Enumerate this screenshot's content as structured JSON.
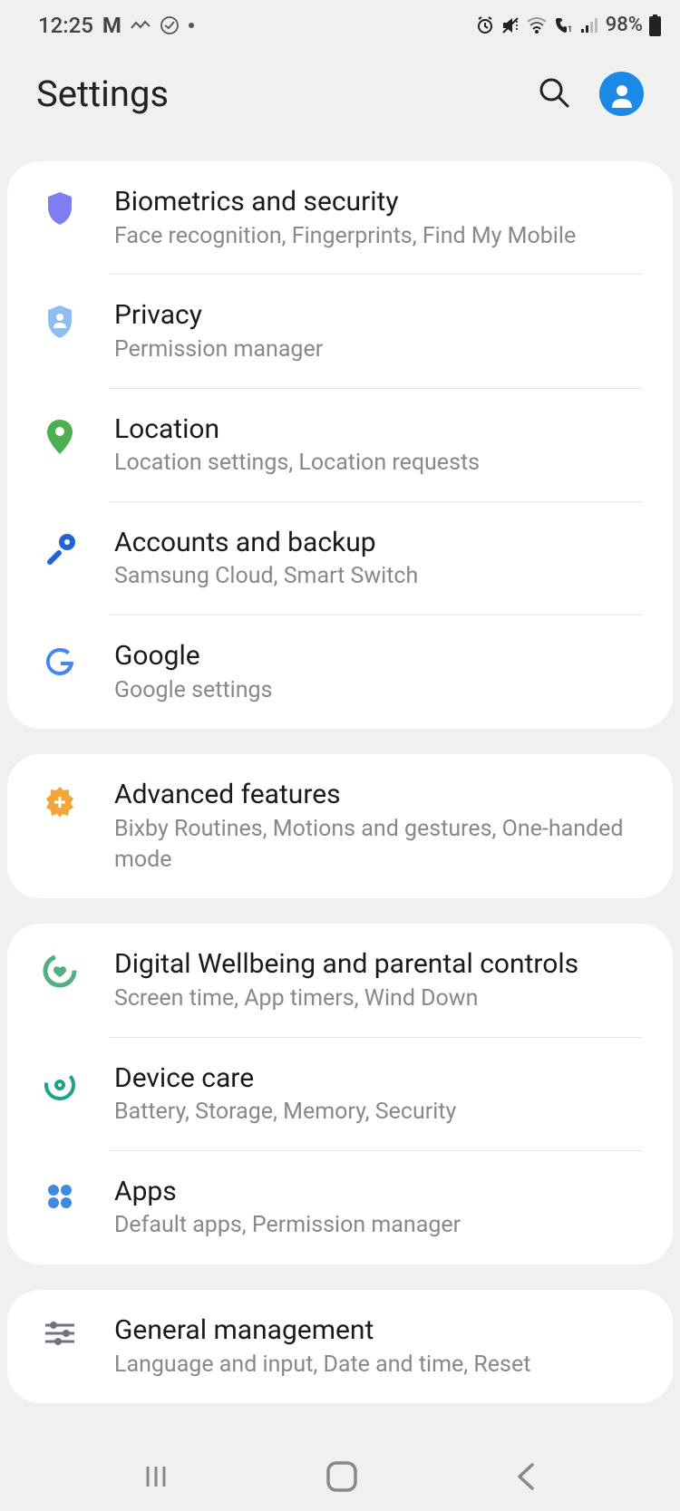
{
  "status": {
    "time": "12:25",
    "battery": "98%"
  },
  "header": {
    "title": "Settings"
  },
  "groups": [
    {
      "items": [
        {
          "id": "biometrics",
          "title": "Biometrics and security",
          "subtitle": "Face recognition, Fingerprints, Find My Mobile",
          "icon": "shield",
          "color": "#7e7ef1"
        },
        {
          "id": "privacy",
          "title": "Privacy",
          "subtitle": "Permission manager",
          "icon": "shield-user",
          "color": "#8ebef0"
        },
        {
          "id": "location",
          "title": "Location",
          "subtitle": "Location settings, Location requests",
          "icon": "pin",
          "color": "#4caf50"
        },
        {
          "id": "accounts",
          "title": "Accounts and backup",
          "subtitle": "Samsung Cloud, Smart Switch",
          "icon": "key",
          "color": "#2163d4"
        },
        {
          "id": "google",
          "title": "Google",
          "subtitle": "Google settings",
          "icon": "google",
          "color": "#4285f4"
        }
      ]
    },
    {
      "items": [
        {
          "id": "advanced",
          "title": "Advanced features",
          "subtitle": "Bixby Routines, Motions and gestures, One-handed mode",
          "icon": "gear-plus",
          "color": "#f2a63a"
        }
      ]
    },
    {
      "items": [
        {
          "id": "wellbeing",
          "title": "Digital Wellbeing and parental controls",
          "subtitle": "Screen time, App timers, Wind Down",
          "icon": "wellbeing",
          "color": "#51b07e"
        },
        {
          "id": "devicecare",
          "title": "Device care",
          "subtitle": "Battery, Storage, Memory, Security",
          "icon": "device-care",
          "color": "#1ca18a"
        },
        {
          "id": "apps",
          "title": "Apps",
          "subtitle": "Default apps, Permission manager",
          "icon": "apps",
          "color": "#3f8ae0"
        }
      ]
    },
    {
      "items": [
        {
          "id": "general",
          "title": "General management",
          "subtitle": "Language and input, Date and time, Reset",
          "icon": "sliders",
          "color": "#6e7582"
        }
      ]
    }
  ]
}
